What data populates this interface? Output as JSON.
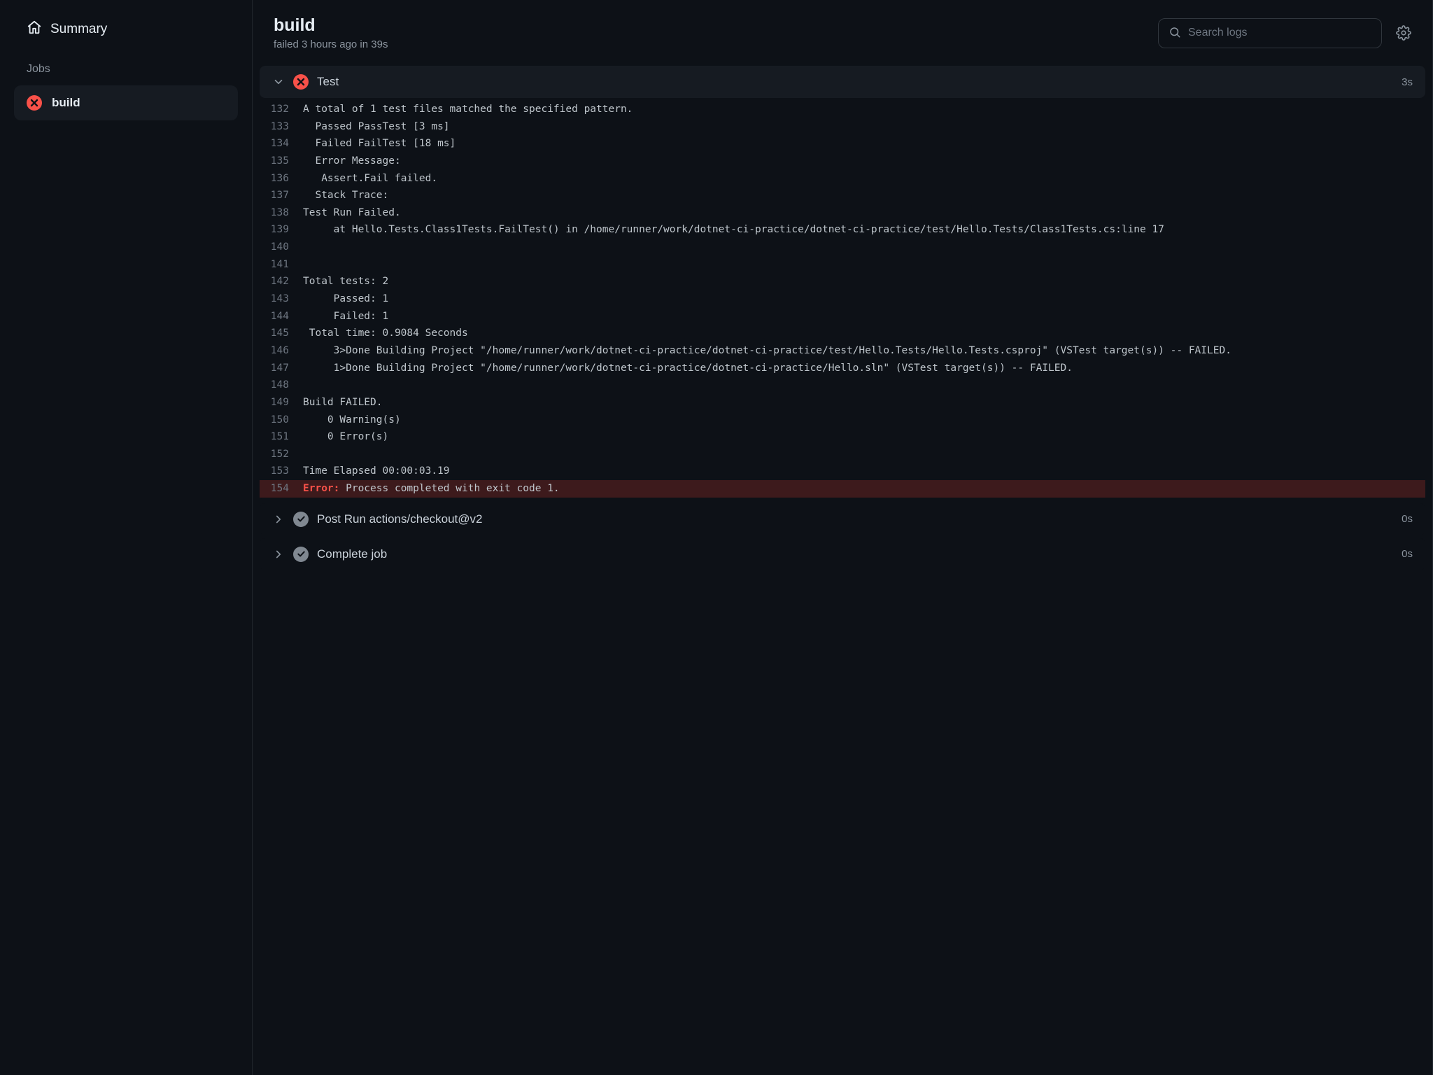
{
  "sidebar": {
    "summary_label": "Summary",
    "jobs_label": "Jobs",
    "job_name": "build"
  },
  "header": {
    "title": "build",
    "subtitle": "failed 3 hours ago in 39s",
    "search_placeholder": "Search logs"
  },
  "steps": {
    "test": {
      "name": "Test",
      "duration": "3s"
    },
    "post_checkout": {
      "name": "Post Run actions/checkout@v2",
      "duration": "0s"
    },
    "complete": {
      "name": "Complete job",
      "duration": "0s"
    }
  },
  "log": {
    "error_label": "Error:",
    "lines": [
      {
        "n": 132,
        "t": "A total of 1 test files matched the specified pattern."
      },
      {
        "n": 133,
        "t": "  Passed PassTest [3 ms]"
      },
      {
        "n": 134,
        "t": "  Failed FailTest [18 ms]"
      },
      {
        "n": 135,
        "t": "  Error Message:"
      },
      {
        "n": 136,
        "t": "   Assert.Fail failed."
      },
      {
        "n": 137,
        "t": "  Stack Trace:"
      },
      {
        "n": 138,
        "t": "Test Run Failed."
      },
      {
        "n": 139,
        "t": "     at Hello.Tests.Class1Tests.FailTest() in /home/runner/work/dotnet-ci-practice/dotnet-ci-practice/test/Hello.Tests/Class1Tests.cs:line 17"
      },
      {
        "n": 140,
        "t": ""
      },
      {
        "n": 141,
        "t": ""
      },
      {
        "n": 142,
        "t": "Total tests: 2"
      },
      {
        "n": 143,
        "t": "     Passed: 1"
      },
      {
        "n": 144,
        "t": "     Failed: 1"
      },
      {
        "n": 145,
        "t": " Total time: 0.9084 Seconds"
      },
      {
        "n": 146,
        "t": "     3>Done Building Project \"/home/runner/work/dotnet-ci-practice/dotnet-ci-practice/test/Hello.Tests/Hello.Tests.csproj\" (VSTest target(s)) -- FAILED."
      },
      {
        "n": 147,
        "t": "     1>Done Building Project \"/home/runner/work/dotnet-ci-practice/dotnet-ci-practice/Hello.sln\" (VSTest target(s)) -- FAILED."
      },
      {
        "n": 148,
        "t": ""
      },
      {
        "n": 149,
        "t": "Build FAILED."
      },
      {
        "n": 150,
        "t": "    0 Warning(s)"
      },
      {
        "n": 151,
        "t": "    0 Error(s)"
      },
      {
        "n": 152,
        "t": ""
      },
      {
        "n": 153,
        "t": "Time Elapsed 00:00:03.19"
      },
      {
        "n": 154,
        "t": " Process completed with exit code 1.",
        "error": true
      }
    ]
  }
}
